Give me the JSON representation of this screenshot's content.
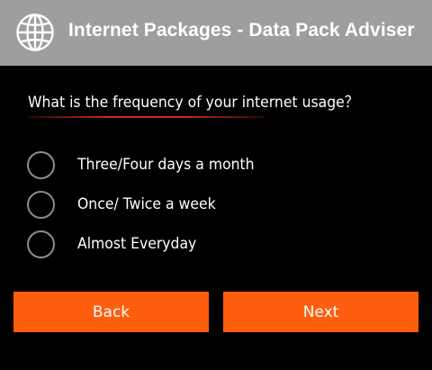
{
  "header": {
    "icon": "globe-icon",
    "title": "Internet Packages - Data Pack Adviser",
    "background": "#9e9e9e"
  },
  "question": {
    "text": "What is the frequency of your internet usage？",
    "underline_color": "#c9321a"
  },
  "options": [
    {
      "label": "Three/Four days a month",
      "selected": false
    },
    {
      "label": "Once/ Twice a week",
      "selected": false
    },
    {
      "label": "Almost Everyday",
      "selected": false
    }
  ],
  "buttons": {
    "back_label": "Back",
    "next_label": "Next",
    "color": "#ff5e0f"
  }
}
